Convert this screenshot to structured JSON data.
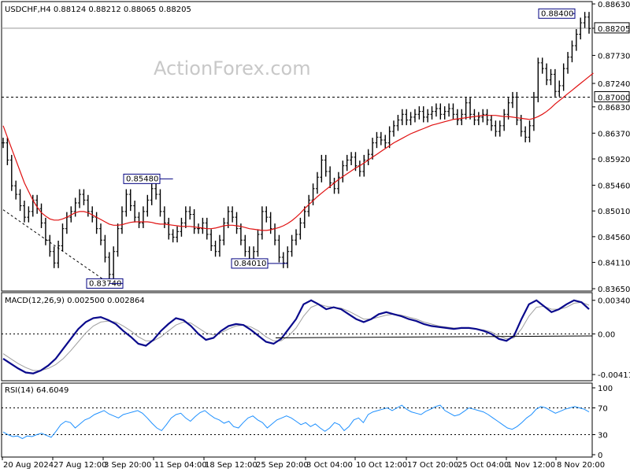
{
  "chart_data": [
    {
      "type": "candlestick",
      "symbol_header": "USDCHF,H4  0.88124 0.88212 0.88065 0.88205",
      "watermark": "ActionForex.com",
      "ylim": [
        0.8365,
        0.8863
      ],
      "y_ticks": [
        "0.88630",
        "0.88205",
        "0.87730",
        "0.87240",
        "0.86830",
        "0.86370",
        "0.85920",
        "0.85460",
        "0.85010",
        "0.84560",
        "0.84110",
        "0.83650"
      ],
      "current_price_label": "0.88205",
      "horizontal_line": {
        "value": 0.87,
        "label": "0.87000"
      },
      "annotations": [
        "0.88400",
        "0.85480",
        "0.83740",
        "0.84010"
      ],
      "close": [
        0.862,
        0.859,
        0.8545,
        0.853,
        0.851,
        0.849,
        0.85,
        0.852,
        0.8505,
        0.848,
        0.845,
        0.843,
        0.841,
        0.844,
        0.847,
        0.849,
        0.85,
        0.8515,
        0.853,
        0.852,
        0.85,
        0.849,
        0.847,
        0.845,
        0.842,
        0.839,
        0.843,
        0.847,
        0.85,
        0.853,
        0.851,
        0.849,
        0.848,
        0.85,
        0.852,
        0.854,
        0.853,
        0.85,
        0.848,
        0.846,
        0.8455,
        0.8465,
        0.848,
        0.85,
        0.8495,
        0.847,
        0.847,
        0.848,
        0.846,
        0.844,
        0.843,
        0.845,
        0.848,
        0.85,
        0.849,
        0.847,
        0.845,
        0.843,
        0.841,
        0.843,
        0.846,
        0.85,
        0.849,
        0.847,
        0.845,
        0.842,
        0.841,
        0.843,
        0.845,
        0.846,
        0.848,
        0.85,
        0.852,
        0.854,
        0.856,
        0.859,
        0.857,
        0.855,
        0.854,
        0.856,
        0.858,
        0.859,
        0.8595,
        0.858,
        0.857,
        0.859,
        0.86,
        0.862,
        0.863,
        0.8625,
        0.862,
        0.864,
        0.865,
        0.866,
        0.867,
        0.866,
        0.8665,
        0.867,
        0.8675,
        0.8665,
        0.867,
        0.8675,
        0.868,
        0.867,
        0.8675,
        0.868,
        0.867,
        0.866,
        0.867,
        0.869,
        0.867,
        0.866,
        0.8665,
        0.867,
        0.866,
        0.865,
        0.864,
        0.865,
        0.867,
        0.869,
        0.87,
        0.866,
        0.864,
        0.863,
        0.865,
        0.87,
        0.876,
        0.875,
        0.873,
        0.874,
        0.871,
        0.872,
        0.875,
        0.877,
        0.879,
        0.881,
        0.883,
        0.884,
        0.882
      ],
      "ma": [
        0.865,
        0.863,
        0.861,
        0.859,
        0.857,
        0.855,
        0.8535,
        0.852,
        0.8508,
        0.8498,
        0.8492,
        0.8487,
        0.8485,
        0.8485,
        0.8487,
        0.849,
        0.8494,
        0.8498,
        0.85,
        0.85,
        0.8498,
        0.8494,
        0.849,
        0.8486,
        0.8482,
        0.8478,
        0.8476,
        0.8476,
        0.8477,
        0.8479,
        0.8481,
        0.8482,
        0.8482,
        0.8482,
        0.8482,
        0.8481,
        0.8479,
        0.8478,
        0.8478,
        0.8477,
        0.8476,
        0.8475,
        0.8474,
        0.8474,
        0.8474,
        0.8473,
        0.8472,
        0.8471,
        0.847,
        0.847,
        0.8471,
        0.8473,
        0.8475,
        0.8476,
        0.8476,
        0.8475,
        0.8474,
        0.8472,
        0.847,
        0.8469,
        0.8468,
        0.8467,
        0.8467,
        0.8468,
        0.847,
        0.8472,
        0.8475,
        0.8479,
        0.8484,
        0.849,
        0.8497,
        0.8505,
        0.8512,
        0.8519,
        0.8526,
        0.8532,
        0.8538,
        0.8544,
        0.855,
        0.8556,
        0.8561,
        0.8566,
        0.8571,
        0.8576,
        0.858,
        0.8585,
        0.859,
        0.8595,
        0.86,
        0.8605,
        0.861,
        0.8615,
        0.862,
        0.8624,
        0.8628,
        0.8632,
        0.8636,
        0.8639,
        0.8642,
        0.8645,
        0.8648,
        0.8651,
        0.8653,
        0.8655,
        0.8657,
        0.8659,
        0.8661,
        0.8662,
        0.8663,
        0.8664,
        0.8665,
        0.8666,
        0.8667,
        0.8668,
        0.8668,
        0.8668,
        0.8668,
        0.8667,
        0.8666,
        0.8666,
        0.8665,
        0.8664,
        0.8663,
        0.8662,
        0.8661,
        0.8663,
        0.8666,
        0.867,
        0.8675,
        0.8681,
        0.8688,
        0.8694,
        0.87,
        0.8706,
        0.8712,
        0.8718,
        0.8724,
        0.873,
        0.8736,
        0.8742
      ]
    },
    {
      "type": "line",
      "label": "MACD(12,26,9) 0.002500 0.002864",
      "ylim": [
        -0.0045,
        0.0037
      ],
      "y_ticks": [
        "0.003402",
        "0.00",
        "-0.00411"
      ],
      "macd": [
        -0.0025,
        -0.003,
        -0.0035,
        -0.0039,
        -0.004,
        -0.0037,
        -0.0032,
        -0.0025,
        -0.0015,
        -0.0005,
        0.0005,
        0.0012,
        0.0016,
        0.0017,
        0.0014,
        0.001,
        0.0003,
        -0.0003,
        -0.001,
        -0.0012,
        -0.0006,
        0.0003,
        0.001,
        0.0016,
        0.0014,
        0.0008,
        0.0,
        -0.0006,
        -0.0004,
        0.0003,
        0.0008,
        0.001,
        0.0009,
        0.0004,
        -0.0002,
        -0.0008,
        -0.001,
        -0.0005,
        0.0005,
        0.0015,
        0.003,
        0.0034,
        0.003,
        0.0025,
        0.0027,
        0.0025,
        0.002,
        0.0015,
        0.0012,
        0.0015,
        0.002,
        0.0022,
        0.002,
        0.0018,
        0.0015,
        0.0013,
        0.001,
        0.0008,
        0.0007,
        0.0006,
        0.0005,
        0.0006,
        0.0006,
        0.0005,
        0.0003,
        0.0,
        -0.0005,
        -0.0007,
        -0.0002,
        0.0015,
        0.003,
        0.0034,
        0.0028,
        0.0022,
        0.0025,
        0.003,
        0.0034,
        0.0032,
        0.0025
      ],
      "signal": [
        -0.002,
        -0.0025,
        -0.003,
        -0.0034,
        -0.0037,
        -0.0037,
        -0.0035,
        -0.0031,
        -0.0025,
        -0.0017,
        -0.0008,
        0.0001,
        0.0008,
        0.0012,
        0.0013,
        0.0012,
        0.0008,
        0.0003,
        -0.0003,
        -0.0007,
        -0.0007,
        -0.0003,
        0.0003,
        0.0009,
        0.0012,
        0.0011,
        0.0006,
        0.0001,
        -0.0001,
        0.0001,
        0.0005,
        0.0008,
        0.0009,
        0.0007,
        0.0003,
        -0.0003,
        -0.0007,
        -0.0007,
        -0.0002,
        0.0006,
        0.0018,
        0.0027,
        0.003,
        0.0028,
        0.0027,
        0.0026,
        0.0023,
        0.0019,
        0.0015,
        0.0015,
        0.0017,
        0.0019,
        0.002,
        0.0019,
        0.0017,
        0.0015,
        0.0012,
        0.001,
        0.0008,
        0.0007,
        0.0006,
        0.0006,
        0.0006,
        0.0005,
        0.0004,
        0.0002,
        -0.0002,
        -0.0005,
        -0.0004,
        0.0005,
        0.0018,
        0.0027,
        0.0028,
        0.0025,
        0.0025,
        0.0027,
        0.0031,
        0.0032,
        0.0029
      ]
    },
    {
      "type": "line",
      "label": "RSI(14) 64.6049",
      "ylim": [
        0,
        100
      ],
      "y_ticks": [
        "100",
        "70",
        "30",
        "0"
      ],
      "levels": [
        70,
        30
      ],
      "values": [
        34,
        30,
        27,
        28,
        24,
        28,
        27,
        30,
        32,
        29,
        26,
        35,
        45,
        50,
        48,
        40,
        46,
        52,
        55,
        60,
        63,
        66,
        61,
        58,
        55,
        60,
        62,
        64,
        66,
        62,
        55,
        47,
        40,
        36,
        45,
        55,
        60,
        62,
        55,
        50,
        57,
        63,
        66,
        60,
        55,
        52,
        47,
        50,
        42,
        40,
        48,
        55,
        58,
        52,
        48,
        40,
        46,
        52,
        55,
        58,
        55,
        50,
        45,
        48,
        42,
        46,
        40,
        35,
        40,
        48,
        45,
        36,
        42,
        52,
        55,
        48,
        60,
        64,
        66,
        68,
        70,
        66,
        70,
        74,
        68,
        64,
        62,
        60,
        65,
        68,
        72,
        74,
        66,
        62,
        58,
        60,
        65,
        70,
        68,
        66,
        64,
        60,
        55,
        50,
        45,
        40,
        38,
        42,
        48,
        55,
        60,
        68,
        72,
        70,
        66,
        62,
        65,
        68,
        70,
        72,
        70,
        68,
        64
      ]
    }
  ],
  "time_axis": [
    "20 Aug 2024",
    "27 Aug 12:00",
    "3 Sep 20:00",
    "11 Sep 04:00",
    "18 Sep 12:00",
    "25 Sep 20:00",
    "3 Oct 04:00",
    "10 Oct 12:00",
    "17 Oct 20:00",
    "25 Oct 04:00",
    "1 Nov 12:00",
    "8 Nov 20:00"
  ],
  "colors": {
    "candle": "#000000",
    "ma": "#e01010",
    "macd_line": "#0a0a8c",
    "signal_line": "#a0a0a0",
    "rsi_line": "#1e90ff",
    "grid": "#000000",
    "label_border": "#000080",
    "label_text": "#000080"
  }
}
